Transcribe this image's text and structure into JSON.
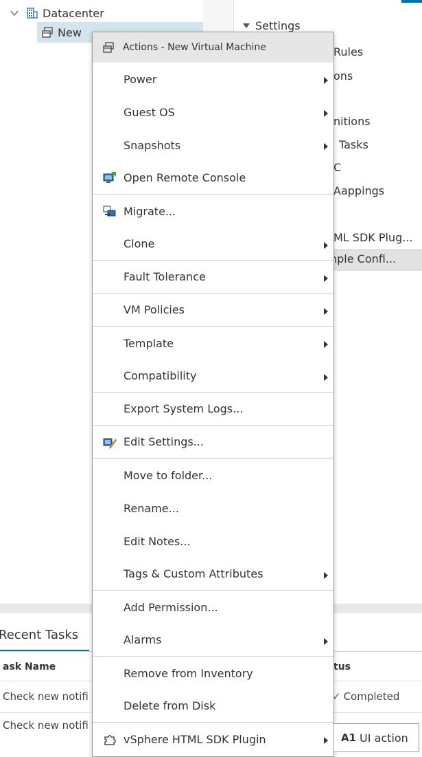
{
  "tree": {
    "datacenter_label": "Datacenter",
    "vm_label_visible": "New"
  },
  "right_pane": {
    "settings_header": "Settings",
    "items": [
      "Rules",
      "ons",
      "nitions",
      "Tasks",
      "C",
      "Aappings",
      "ML SDK Plug...",
      "nple Confi..."
    ]
  },
  "menu": {
    "header": "Actions - New Virtual Machine",
    "items": [
      {
        "label": "Power",
        "submenu": true
      },
      {
        "label": "Guest OS",
        "submenu": true
      },
      {
        "label": "Snapshots",
        "submenu": true
      },
      {
        "label": "Open Remote Console",
        "icon": "remote-console-icon"
      },
      {
        "label": "Migrate...",
        "icon": "migrate-icon"
      },
      {
        "label": "Clone",
        "submenu": true
      },
      {
        "label": "Fault Tolerance",
        "submenu": true
      },
      {
        "label": "VM Policies",
        "submenu": true
      },
      {
        "label": "Template",
        "submenu": true
      },
      {
        "label": "Compatibility",
        "submenu": true
      },
      {
        "label": "Export System Logs..."
      },
      {
        "label": "Edit Settings...",
        "icon": "edit-settings-icon"
      },
      {
        "label": "Move to folder..."
      },
      {
        "label": "Rename..."
      },
      {
        "label": "Edit Notes..."
      },
      {
        "label": "Tags & Custom Attributes",
        "submenu": true
      },
      {
        "label": "Add Permission..."
      },
      {
        "label": "Alarms",
        "submenu": true
      },
      {
        "label": "Remove from Inventory"
      },
      {
        "label": "Delete from Disk"
      },
      {
        "label": "vSphere HTML SDK Plugin",
        "submenu": true,
        "icon": "plugin-icon"
      }
    ]
  },
  "flyout": {
    "prefix": "A1",
    "label": "UI action"
  },
  "recent_tasks": {
    "tab_label": "Recent Tasks",
    "col_task_name": "ask Name",
    "col_status": "tus",
    "rows": [
      {
        "task": "Check new notifi",
        "status": "Completed"
      },
      {
        "task": "Check new notifi",
        "status": ""
      }
    ]
  },
  "colors": {
    "accent": "#0072a3",
    "selected_row": "#d4e4ef",
    "menu_header_bg": "#e6e6e6"
  }
}
